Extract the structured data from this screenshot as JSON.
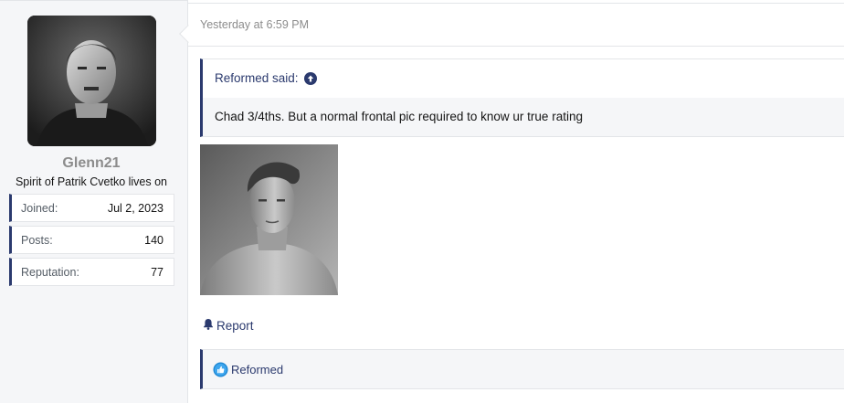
{
  "user": {
    "name": "Glenn21",
    "title": "Spirit of Patrik Cvetko lives on",
    "stats": [
      {
        "label": "Joined:",
        "value": "Jul 2, 2023"
      },
      {
        "label": "Posts:",
        "value": "140"
      },
      {
        "label": "Reputation:",
        "value": "77"
      }
    ]
  },
  "post": {
    "timestamp": "Yesterday at 6:59 PM",
    "quote": {
      "author_said": "Reformed said:",
      "text": "Chad 3/4ths. But a normal frontal pic required to know ur true rating"
    },
    "report_label": "Report",
    "reactions": {
      "users": "Reformed",
      "icon": "like-icon"
    }
  },
  "colors": {
    "accent": "#2b3a6e",
    "sidebar_bg": "#f5f6f8",
    "muted_text": "#8c8c8c"
  }
}
